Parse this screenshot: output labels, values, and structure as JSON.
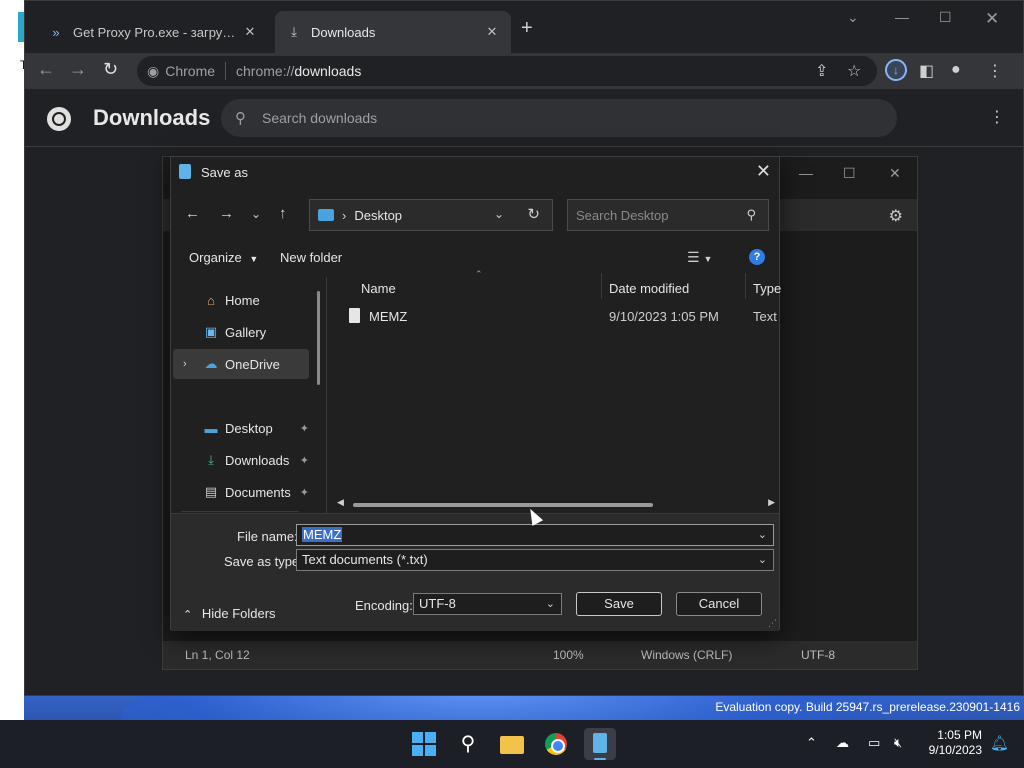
{
  "desktop": {
    "left_letter": "T",
    "watermark": {
      "line1": "",
      "line2": "Evaluation copy. Build 25947.rs_prerelease.230901-1416"
    }
  },
  "chrome": {
    "tabs": [
      {
        "title": "Get Proxy Pro.exe - загрузить фа",
        "icon": "proxy-icon",
        "active": false
      },
      {
        "title": "Downloads",
        "icon": "download-icon",
        "active": true
      }
    ],
    "new_tab": "+",
    "omnibox": {
      "site_label": "Chrome",
      "protocol": "chrome://",
      "host": "downloads"
    },
    "page": {
      "title": "Downloads",
      "search_placeholder": "Search downloads"
    }
  },
  "notepad": {
    "status": {
      "position": "Ln 1, Col 12",
      "zoom": "100%",
      "line_ending": "Windows (CRLF)",
      "encoding": "UTF-8"
    }
  },
  "dialog": {
    "title": "Save as",
    "address": {
      "location": "Desktop"
    },
    "search_placeholder": "Search Desktop",
    "commands": {
      "organize": "Organize",
      "new_folder": "New folder"
    },
    "nav_pane": {
      "items": [
        {
          "label": "Home",
          "icon": "home-icon"
        },
        {
          "label": "Gallery",
          "icon": "gallery-icon"
        },
        {
          "label": "OneDrive",
          "icon": "cloud-icon"
        },
        {
          "label": "Desktop",
          "icon": "desktop-icon"
        },
        {
          "label": "Downloads",
          "icon": "download-icon"
        },
        {
          "label": "Documents",
          "icon": "document-icon"
        }
      ]
    },
    "columns": {
      "name": "Name",
      "date": "Date modified",
      "type": "Type"
    },
    "files": [
      {
        "name": "MEMZ",
        "date": "9/10/2023 1:05 PM",
        "type": "Text Document"
      }
    ],
    "form": {
      "file_name_label": "File name:",
      "file_name_value": "MEMZ",
      "type_label": "Save as type:",
      "type_value": "Text documents (*.txt)",
      "encoding_label": "Encoding:",
      "encoding_value": "UTF-8",
      "save": "Save",
      "cancel": "Cancel",
      "hide_folders": "Hide Folders"
    }
  },
  "taskbar": {
    "clock": {
      "time": "1:05 PM",
      "date": "9/10/2023"
    }
  },
  "colors": {
    "accent": "#4ab0f4",
    "selection": "#3c6fc6",
    "dialog_bg": "#202020"
  }
}
